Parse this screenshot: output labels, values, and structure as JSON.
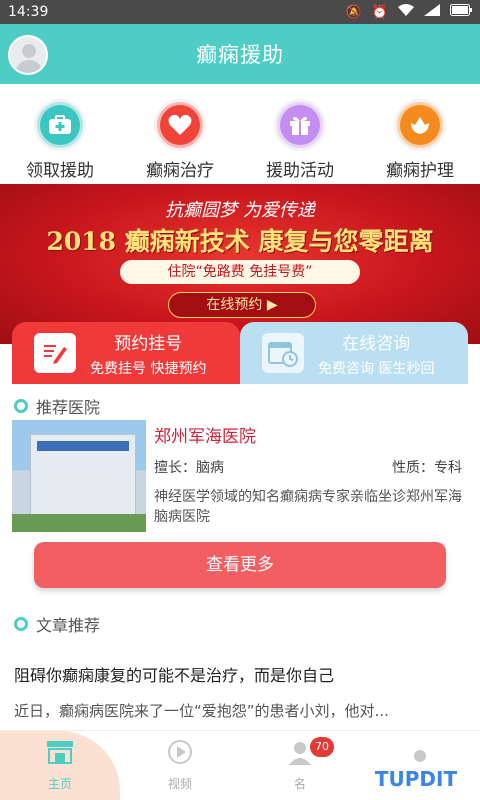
{
  "status_bar": {
    "time": "14:39",
    "icons": [
      "mute-icon",
      "alarm-icon",
      "wifi-icon",
      "signal-icon",
      "battery-icon"
    ]
  },
  "app_bar": {
    "title": "癫痫援助"
  },
  "quick_menu": [
    {
      "label": "领取援助",
      "icon": "medical-kit-icon",
      "color": "#3cc6c0"
    },
    {
      "label": "癫痫治疗",
      "icon": "heart-icon",
      "color": "#f0443a"
    },
    {
      "label": "援助活动",
      "icon": "gift-icon",
      "color": "#c48ef0"
    },
    {
      "label": "癫痫护理",
      "icon": "flower-icon",
      "color": "#f58a1f"
    }
  ],
  "banner": {
    "slogan": "抗癫圆梦 为爱传递",
    "headline": "2018 癫痫新技术 康复与您零距离",
    "free_text": "住院“免路费 免挂号费”",
    "button": "在线预约 ▶"
  },
  "cards": {
    "appoint": {
      "title": "预约挂号",
      "sub": "免费挂号 快捷预约"
    },
    "consult": {
      "title": "在线咨询",
      "sub": "免费咨询 医生秒回"
    }
  },
  "hospital_section": {
    "title": "推荐医院",
    "hospital": {
      "name": "郑州军海医院",
      "specialty": "擅长：脑病",
      "nature": "性质：专科",
      "description": "神经医学领域的知名癫痫病专家亲临坐诊郑州军海脑病医院"
    },
    "more_button": "查看更多"
  },
  "article_section": {
    "title": "文章推荐",
    "article": {
      "title": "阻碍你癫痫康复的可能不是治疗，而是你自己",
      "summary": "近日，癫痫病医院来了一位“爱抱怨”的患者小刘，他对..."
    }
  },
  "tabbar": [
    {
      "label": "主页",
      "icon": "store-icon"
    },
    {
      "label": "视频",
      "icon": "video-icon"
    },
    {
      "label": "名",
      "icon": "doctor-icon",
      "badge": "70"
    },
    {
      "label": "",
      "icon": "profile-icon"
    }
  ],
  "watermark": "TUPDIT"
}
